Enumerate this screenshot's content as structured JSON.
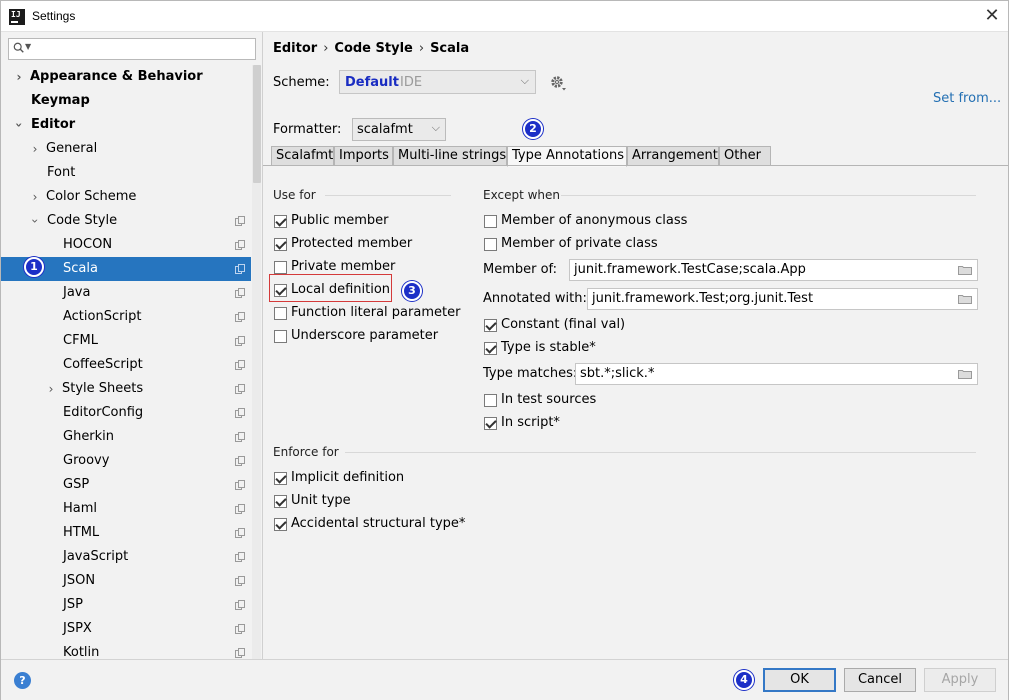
{
  "window": {
    "title": "Settings",
    "close": "✕"
  },
  "search": {
    "placeholder": ""
  },
  "sidebar": {
    "items": [
      {
        "label": "Appearance & Behavior"
      },
      {
        "label": "Keymap"
      },
      {
        "label": "Editor"
      },
      {
        "label": "General"
      },
      {
        "label": "Font"
      },
      {
        "label": "Color Scheme"
      },
      {
        "label": "Code Style"
      },
      {
        "label": "HOCON"
      },
      {
        "label": "Scala"
      },
      {
        "label": "Java"
      },
      {
        "label": "ActionScript"
      },
      {
        "label": "CFML"
      },
      {
        "label": "CoffeeScript"
      },
      {
        "label": "Style Sheets"
      },
      {
        "label": "EditorConfig"
      },
      {
        "label": "Gherkin"
      },
      {
        "label": "Groovy"
      },
      {
        "label": "GSP"
      },
      {
        "label": "Haml"
      },
      {
        "label": "HTML"
      },
      {
        "label": "JavaScript"
      },
      {
        "label": "JSON"
      },
      {
        "label": "JSP"
      },
      {
        "label": "JSPX"
      },
      {
        "label": "Kotlin"
      }
    ]
  },
  "callouts": {
    "c1": "1",
    "c2": "2",
    "c3": "3",
    "c4": "4"
  },
  "breadcrumb": {
    "a": "Editor",
    "b": "Code Style",
    "c": "Scala",
    "sep": "›"
  },
  "scheme": {
    "label": "Scheme:",
    "name": "Default",
    "suffix": "IDE"
  },
  "set_from": "Set from...",
  "formatter": {
    "label": "Formatter:",
    "value": "scalafmt"
  },
  "tabs": [
    "Scalafmt",
    "Imports",
    "Multi-line strings",
    "Type Annotations",
    "Arrangement",
    "Other"
  ],
  "use_for": {
    "title": "Use for",
    "items": [
      {
        "label": "Public member",
        "checked": true
      },
      {
        "label": "Protected member",
        "checked": true
      },
      {
        "label": "Private member",
        "checked": false
      },
      {
        "label": "Local definition",
        "checked": true
      },
      {
        "label": "Function literal parameter",
        "checked": false
      },
      {
        "label": "Underscore parameter",
        "checked": false
      }
    ]
  },
  "except_when": {
    "title": "Except when",
    "anon": {
      "label": "Member of anonymous class",
      "checked": false
    },
    "private_class": {
      "label": "Member of private class",
      "checked": false
    },
    "member_of": {
      "label": "Member of:",
      "value": "junit.framework.TestCase;scala.App"
    },
    "annotated_with": {
      "label": "Annotated with:",
      "value": "junit.framework.Test;org.junit.Test"
    },
    "constant": {
      "label": "Constant (final val)",
      "checked": true
    },
    "type_stable": {
      "label": "Type is stable*",
      "checked": true
    },
    "type_matches": {
      "label": "Type matches:",
      "value": "sbt.*;slick.*"
    },
    "test_sources": {
      "label": "In test sources",
      "checked": false
    },
    "in_script": {
      "label": "In script*",
      "checked": true
    }
  },
  "enforce_for": {
    "title": "Enforce for",
    "items": [
      {
        "label": "Implicit definition",
        "checked": true
      },
      {
        "label": "Unit type",
        "checked": true
      },
      {
        "label": "Accidental structural type*",
        "checked": true
      }
    ]
  },
  "buttons": {
    "help": "?",
    "ok": "OK",
    "cancel": "Cancel",
    "apply": "Apply"
  },
  "colors": {
    "accent": "#2675bf",
    "callout": "#1c2fc7",
    "link": "#2470b3",
    "highlight": "#d43a3a"
  }
}
